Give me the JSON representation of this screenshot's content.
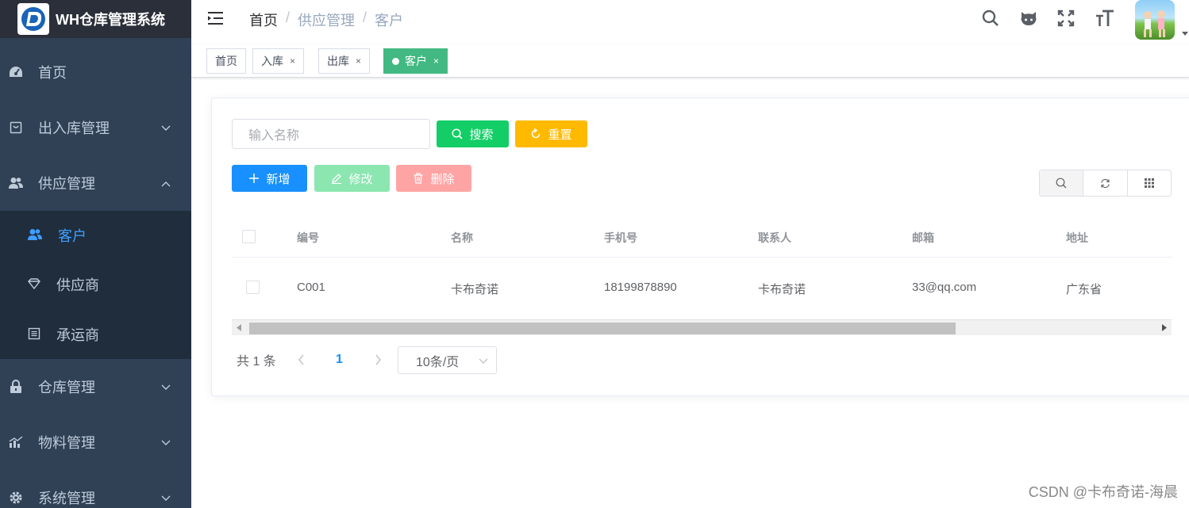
{
  "app": {
    "title": "WH仓库管理系统"
  },
  "sidebar": {
    "items": [
      {
        "label": "首页",
        "icon": "dashboard-icon"
      },
      {
        "label": "出入库管理",
        "icon": "inbox-icon"
      },
      {
        "label": "供应管理",
        "icon": "peoples-icon"
      },
      {
        "label": "仓库管理",
        "icon": "lock-icon"
      },
      {
        "label": "物料管理",
        "icon": "chart-icon"
      },
      {
        "label": "系统管理",
        "icon": "gear-icon"
      }
    ],
    "sub_items": [
      {
        "label": "客户",
        "icon": "user-icon",
        "active": true
      },
      {
        "label": "供应商",
        "icon": "diamond-icon"
      },
      {
        "label": "承运商",
        "icon": "list-icon"
      }
    ],
    "active_color": "#409eff",
    "bg": "#304156"
  },
  "breadcrumb": [
    "首页",
    "供应管理",
    "客户"
  ],
  "tags": [
    {
      "label": "首页"
    },
    {
      "label": "入库",
      "close": "×"
    },
    {
      "label": "出库",
      "close": "×"
    },
    {
      "label": "客户",
      "close": "×",
      "active": true
    }
  ],
  "search": {
    "placeholder": "输入名称",
    "search_label": "搜索",
    "reset_label": "重置"
  },
  "actions": {
    "add_label": "新增",
    "edit_label": "修改",
    "delete_label": "删除"
  },
  "table": {
    "columns": [
      "编号",
      "名称",
      "手机号",
      "联系人",
      "邮箱",
      "地址"
    ],
    "rows": [
      [
        "C001",
        "卡布奇诺",
        "18199878890",
        "卡布奇诺",
        "33@qq.com",
        "广东省"
      ]
    ]
  },
  "pagination": {
    "total_text": "共 1 条",
    "current_page": "1",
    "page_size": "10条/页"
  },
  "watermark": "CSDN @卡布奇诺-海晨",
  "colors": {
    "primary": "#1890ff",
    "success": "#13ce66",
    "warning": "#ffba00",
    "danger": "#ff4949",
    "tag_active": "#42b983"
  }
}
